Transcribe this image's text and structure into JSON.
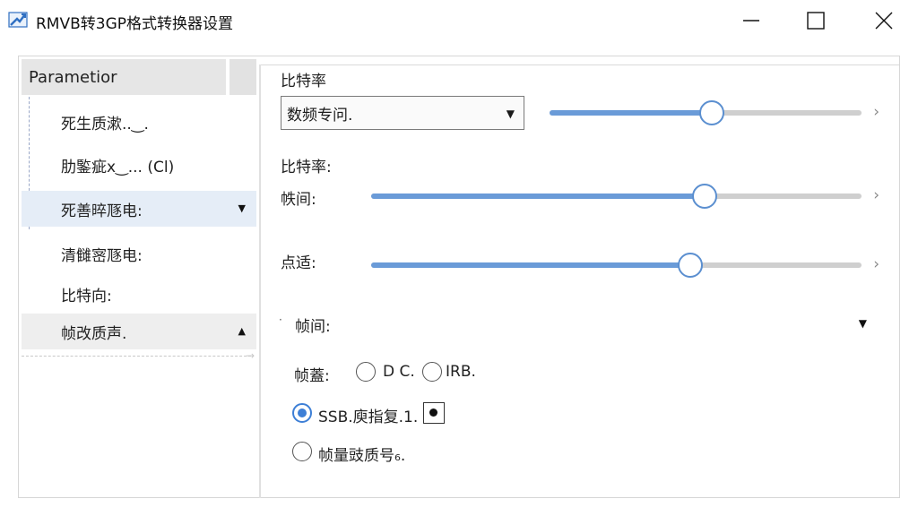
{
  "window": {
    "title": "RMVB转3GP格式转换器设置",
    "controls": [
      "minimize-icon",
      "maximize-icon",
      "close-icon"
    ]
  },
  "tree": {
    "header": "Parametior",
    "items": [
      {
        "label": "死生质漱..‿."
      },
      {
        "label": "肋鍳疵x‿... (Cl)"
      },
      {
        "label": "死善晬豗电:",
        "selected": true,
        "arrow": "▼"
      },
      {
        "label": "清雠宻豗电:"
      },
      {
        "label": "比特向:"
      },
      {
        "label": "帧改质声.",
        "arrow": "▲"
      }
    ]
  },
  "settings": {
    "section1_label": "比特率",
    "dropdown_value": "数频专问.",
    "slider_top": {
      "value": 0.52
    },
    "section2_label": "比特率:",
    "slider_frame": {
      "label": "帙间:",
      "value": 0.68
    },
    "slider_point": {
      "label": "点适:",
      "value": 0.65
    },
    "collapse": {
      "bullet": "·",
      "label": "帧间:"
    },
    "frame_label": "帧蓋:",
    "radio_dc": "D C.",
    "radio_irb": "IRB.",
    "option_checked": "SSB.庾指复.1.",
    "option_quality": "帧量豉质号₆."
  },
  "colors": {
    "accent": "#5b8fd0",
    "selection": "#e5edf7",
    "header_bg": "#e6e6e6"
  }
}
